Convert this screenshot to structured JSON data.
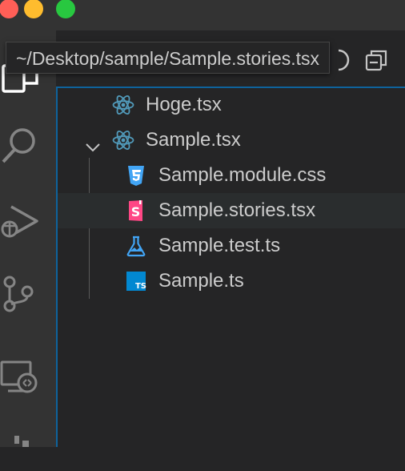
{
  "window": {
    "tooltip": "~/Desktop/sample/Sample.stories.tsx"
  },
  "colors": {
    "close": "#ff5f57",
    "minimize": "#febc2e",
    "zoom": "#28c840",
    "react": "#519aba",
    "css": "#42a5f5",
    "storybook": "#ff4785",
    "test": "#42a5f5",
    "ts": "#0288d1"
  },
  "activity_bar": {
    "items": [
      "explorer-icon",
      "search-icon",
      "run-debug-icon",
      "source-control-icon",
      "remote-explorer-icon",
      "extensions-icon"
    ]
  },
  "tree": {
    "items": [
      {
        "label": "Hoge.tsx",
        "icon": "react-icon"
      },
      {
        "label": "Sample.tsx",
        "icon": "react-icon",
        "expanded": true
      },
      {
        "label": "Sample.module.css",
        "icon": "css-icon"
      },
      {
        "label": "Sample.stories.tsx",
        "icon": "storybook-icon",
        "hovered": true
      },
      {
        "label": "Sample.test.ts",
        "icon": "test-flask-icon"
      },
      {
        "label": "Sample.ts",
        "icon": "typescript-icon"
      }
    ]
  }
}
